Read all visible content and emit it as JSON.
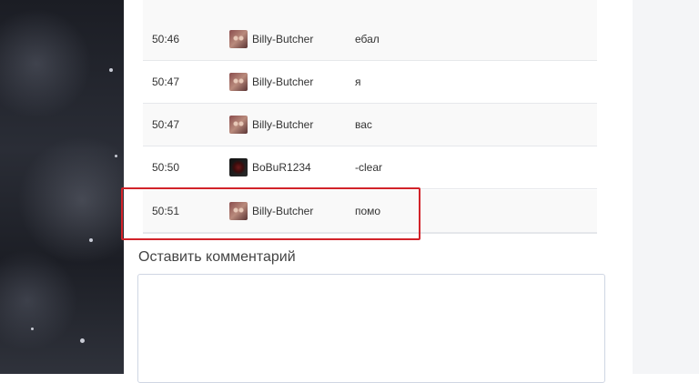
{
  "chat": {
    "rows": [
      {
        "time": "50:46",
        "nick": "Billy-Butcher",
        "message": "ебал"
      },
      {
        "time": "50:47",
        "nick": "Billy-Butcher",
        "message": "я"
      },
      {
        "time": "50:47",
        "nick": "Billy-Butcher",
        "message": "вас"
      },
      {
        "time": "50:50",
        "nick": "BoBuR1234",
        "message": "-clear"
      },
      {
        "time": "50:51",
        "nick": "Billy-Butcher",
        "message": "помо"
      }
    ],
    "highlight_color": "#d2232a"
  },
  "comment": {
    "title": "Оставить комментарий",
    "value": ""
  }
}
